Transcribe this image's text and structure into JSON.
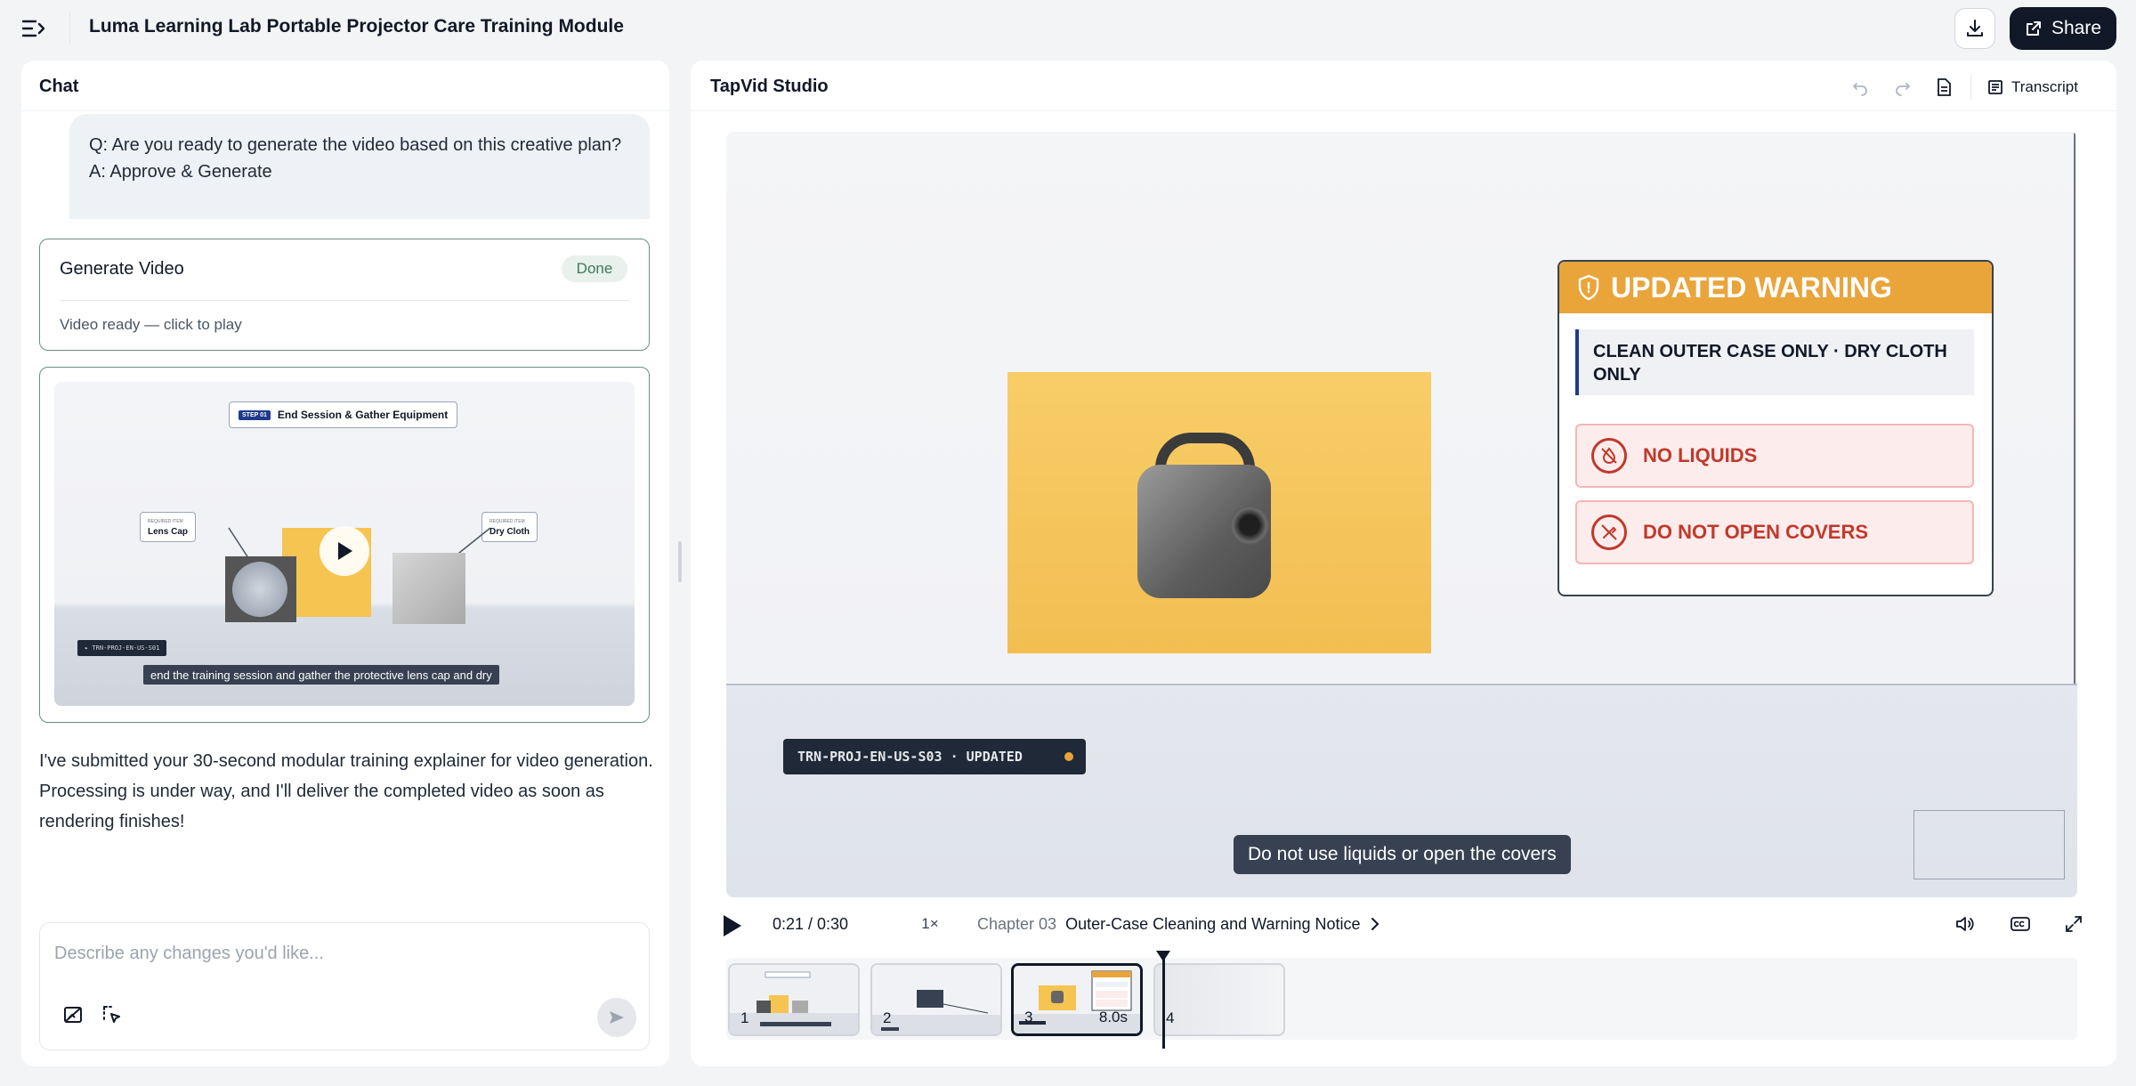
{
  "header": {
    "title": "Luma Learning Lab Portable Projector Care Training Module",
    "share_label": "Share"
  },
  "chat": {
    "title": "Chat",
    "qa_question": "Q: Are you ready to generate the video based on this creative plan?",
    "qa_answer": "A: Approve & Generate",
    "generate_card": {
      "title": "Generate Video",
      "status": "Done",
      "subtitle": "Video ready — click to play"
    },
    "preview": {
      "step_tag": "STEP 01",
      "step_title": "End Session & Gather Equipment",
      "callout_left_small": "REQUIRED ITEM",
      "callout_left": "Lens Cap",
      "callout_right_small": "REQUIRED ITEM",
      "callout_right": "Dry Cloth",
      "id_label": "▸ TRN-PROJ-EN-US-S01",
      "caption": "end the training session and gather the protective lens cap and dry"
    },
    "message": "I've submitted your 30-second modular training explainer for video generation. Processing is under way, and I'll deliver the completed video as soon as rendering finishes!",
    "input_placeholder": "Describe any changes you'd like..."
  },
  "studio": {
    "title": "TapVid Studio",
    "transcript_label": "Transcript",
    "warning": {
      "title": "UPDATED WARNING",
      "note": "CLEAN OUTER CASE ONLY · DRY CLOTH ONLY",
      "item1": "NO LIQUIDS",
      "item2": "DO NOT OPEN COVERS"
    },
    "id_chip": "TRN-PROJ-EN-US-S03 · UPDATED",
    "subtitle": "Do not use liquids or open the covers",
    "controls": {
      "time": "0:21 / 0:30",
      "speed": "1×",
      "chapter_num": "Chapter 03",
      "chapter_title": "Outer-Case Cleaning and Warning Notice"
    },
    "timeline": {
      "clips": [
        "1",
        "2",
        "3",
        "4"
      ],
      "active_duration": "8.0s"
    }
  },
  "colors": {
    "accent_dark": "#111827",
    "warning_orange": "#e9a43a",
    "danger_red": "#c0392b",
    "done_green": "#3c7a5a"
  }
}
